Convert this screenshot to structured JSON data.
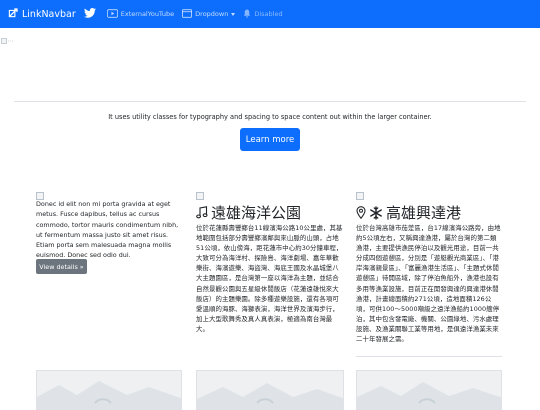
{
  "navbar": {
    "brand_label": "LinkNavbar",
    "items": [
      {
        "label": "",
        "icon": "twitter-icon"
      },
      {
        "label": "ExternalYouTube",
        "icon": "youtube-icon"
      },
      {
        "label": "Dropdown",
        "icon": "window-icon"
      },
      {
        "label": "Disabled",
        "icon": "bell-icon"
      }
    ],
    "color": "#0d6efd"
  },
  "hero": {
    "lead": "It uses utility classes for typography and spacing to space content out within the larger container.",
    "button_label": "Learn more"
  },
  "columns": [
    {
      "text": "Donec id elit non mi porta gravida at eget metus. Fusce dapibus, tellus ac cursus commodo, tortor mauris condimentum nibh, ut fermentum massa justo sit amet risus. Etiam porta sem malesuada magna mollis euismod. Donec sed odio dui.",
      "button_label": "View details »"
    },
    {
      "title": "遠雄海洋公園",
      "icon": "music-note-icon",
      "body": "位於花蓮縣壽豐鄉台11線濱海公路10公里處，其基地範圍包括部分壽豐鄉濱鄰與來山脈的山頭，占地51公頃，依山傍海，距花蓮市中心約30分鐘車程，大致可分為海洋村、探險島、海洋劇場、嘉年華歡樂街、海濱遊樂、海盜灣、海底王國及水晶城堡八大主題園區，是台灣第一座以海洋為主題，並結合自然景觀公園與五星級休閒飯店（花蓮遠雄悅來大飯店）的主題樂園。除多種遊樂設施，還有各項可愛溫順的海豚、海獅表演，海洋世界及濱海步行，加上大型歌舞秀及真人真表演，極適為南台灣最大。"
    },
    {
      "title": "高雄興達港",
      "icons": [
        "location-pin-icon",
        "snowflake-icon"
      ],
      "body": "位於台灣高雄市茄萣區，台17線濱海公路旁，由地約5公頃左右，又稱興達漁港，屬於台灣的第二類漁港，主要提供漁民停泊以及觀光用途，目前一共分成四個遊憩區，分別是「遊艇觀光商業區」、「港岸海濱親景區」、「富麗漁港生活區」、「主題式休閒遊憩區」待開區域，除了停泊魚船外，漁港也設有多用等漁業設施，目前正在開發興達的興達港休閒漁港，計畫總面積約271公頃，造地面積126公頃，可供100～5000噸級之遠洋漁船約1000艘停泊，其中包含發電廠、機關、公園綠地、污水處理設施、及漁業關聯工業等用地，是俱遠洋漁業未來二十年發展之需。"
    }
  ]
}
